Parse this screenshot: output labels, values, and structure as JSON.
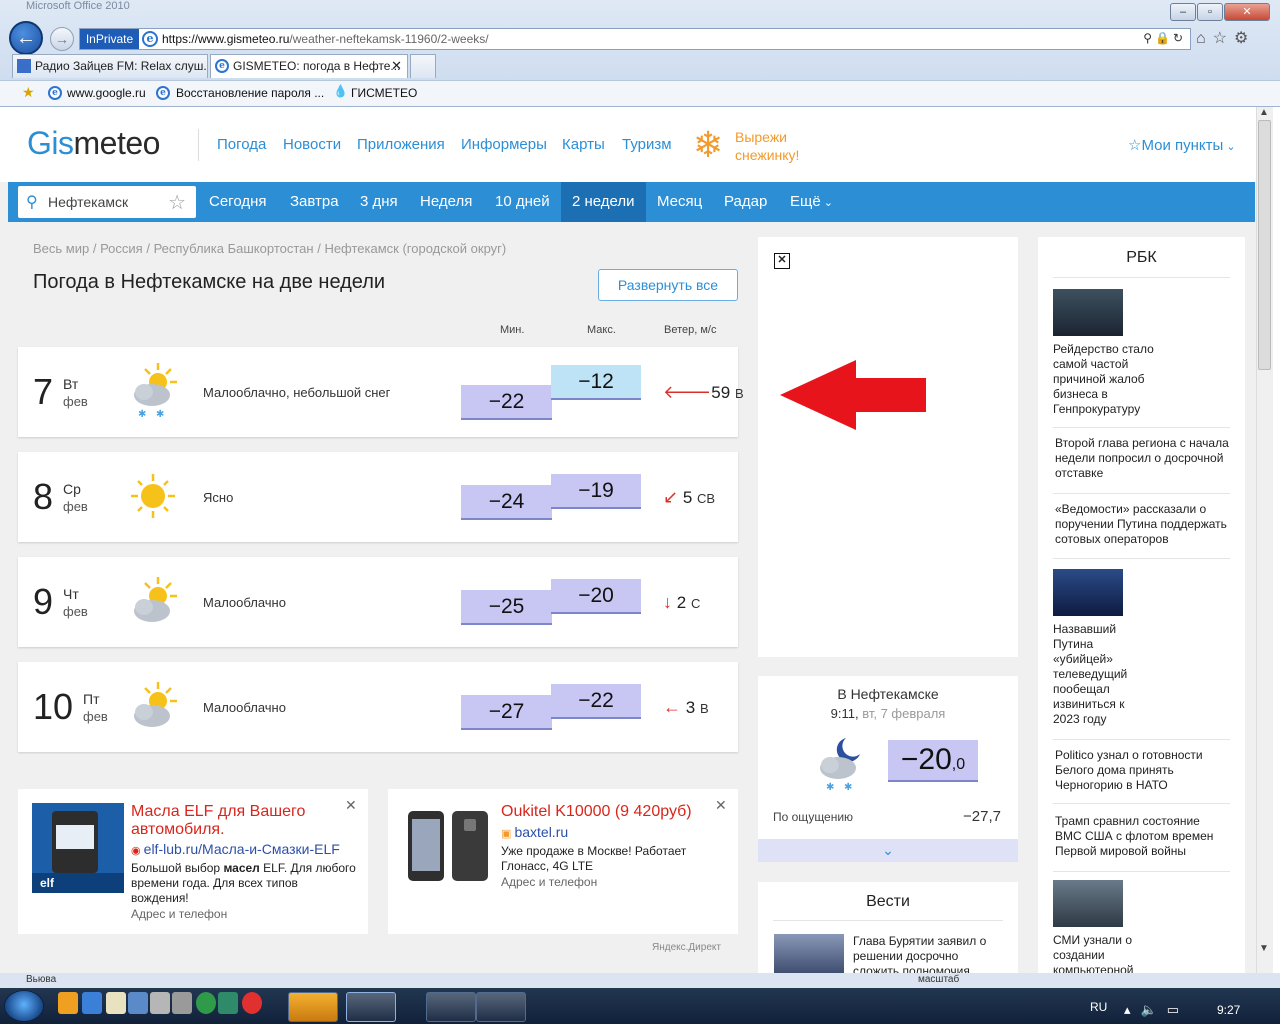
{
  "browser": {
    "window_title": "Microsoft Office 2010",
    "inprivate_label": "InPrivate",
    "url_host": "https://www.gismeteo.ru",
    "url_path": "/weather-neftekamsk-11960/2-weeks/",
    "tabs": [
      {
        "label": "Радио Зайцев FM: Relax слуш..."
      },
      {
        "label": "GISMETEO: погода в Нефте...",
        "active": true
      }
    ],
    "favorites": [
      "www.google.ru",
      "Восстановление пароля ...",
      "ГИСМЕТЕО"
    ]
  },
  "site": {
    "logo_accent": "Gis",
    "logo_rest": "meteo",
    "header_nav": [
      "Погода",
      "Новости",
      "Приложения",
      "Информеры",
      "Карты",
      "Туризм"
    ],
    "promo_line1": "Вырежи",
    "promo_line2": "снежинку!",
    "my_points": "Мои пункты",
    "search_value": "Нефтекамск",
    "forecast_tabs": [
      "Сегодня",
      "Завтра",
      "3 дня",
      "Неделя",
      "10 дней",
      "2 недели",
      "Месяц",
      "Радар",
      "Ещё"
    ],
    "active_tab": "2 недели",
    "accent_color": "#2c8fd6"
  },
  "main": {
    "breadcrumbs": [
      "Весь мир",
      "Россия",
      "Республика Башкортостан",
      "Нефтекамск (городской округ)"
    ],
    "title": "Погода в Нефтекамске на две недели",
    "expand_all": "Развернуть все",
    "col_min": "Мин.",
    "col_max": "Макс.",
    "col_wind": "Ветер, м/с",
    "days": [
      {
        "num": "7",
        "wd": "Вт",
        "mon": "фев",
        "icon": "partly-cloudy-light-snow-icon",
        "desc": "Малооблачно, небольшой снег",
        "tmin": "−22",
        "tmax": "−12",
        "wind_arrow": "🡐",
        "wind_speed": "59",
        "wind_dir": "В"
      },
      {
        "num": "8",
        "wd": "Ср",
        "mon": "фев",
        "icon": "clear-sun-icon",
        "desc": "Ясно",
        "tmin": "−24",
        "tmax": "−19",
        "wind_arrow": "↙",
        "wind_speed": "5",
        "wind_dir": "СВ"
      },
      {
        "num": "9",
        "wd": "Чт",
        "mon": "фев",
        "icon": "partly-cloudy-icon",
        "desc": "Малооблачно",
        "tmin": "−25",
        "tmax": "−20",
        "wind_arrow": "↓",
        "wind_speed": "2",
        "wind_dir": "С"
      },
      {
        "num": "10",
        "wd": "Пт",
        "mon": "фев",
        "icon": "partly-cloudy-icon",
        "desc": "Малооблачно",
        "tmin": "−27",
        "tmax": "−22",
        "wind_arrow": "←",
        "wind_speed": "3",
        "wind_dir": "В"
      }
    ]
  },
  "ads": [
    {
      "title": "Масла ELF для Вашего автомобиля.",
      "link": "elf-lub.ru/Масла-и-Смазки-ELF",
      "text_pre": "Большой выбор ",
      "text_bold": "масел",
      "text_post": " ELF. Для любого времени года. Для всех типов вождения!",
      "addr": "Адрес и телефон"
    },
    {
      "title": "Oukitel K10000 (9 420руб)",
      "link": "baxtel.ru",
      "text": "Уже продаже в Москве! Работает Глонасс, 4G LTE",
      "addr": "Адрес и телефон"
    }
  ],
  "yandex_direct": "Яндекс.Директ",
  "current": {
    "title": "В Нефтекамске",
    "time": "9:11",
    "date": "вт, 7 февраля",
    "temp": "−20",
    "temp_dec": ",0",
    "feels_label": "По ощущению",
    "feels_value": "−27,7"
  },
  "vesti": {
    "title": "Вести",
    "headline": "Глава Бурятии заявил о решении досрочно сложить полномочия"
  },
  "rbk": {
    "title": "РБК",
    "items": [
      "Рейдерство стало самой частой причиной жалоб бизнеса в Генпрокуратуру",
      "Второй глава региона с начала недели попросил о досрочной отставке",
      "«Ведомости» рассказали о поручении Путина поддержать сотовых операторов",
      "Назвавший Путина «убийцей» телеведущий пообещал извиниться к 2023 году",
      "Politico узнал о готовности Белого дома принять Черногорию в НАТО",
      "Трамп сравнил состояние ВМС США с флотом времен Первой мировой войны",
      "СМИ узнали о создании компьютерной"
    ]
  },
  "status": {
    "left": "Вьюва",
    "zoom_label": "масштаб"
  },
  "taskbar": {
    "lang": "RU",
    "clock": "9:27"
  }
}
